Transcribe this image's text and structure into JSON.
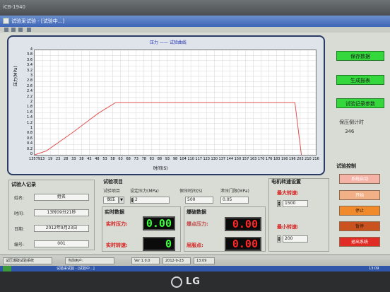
{
  "bezel": {
    "label": "iCB-1940"
  },
  "window": {
    "title": "试验采试验 - [试验中...]"
  },
  "chart": {
    "title": "压力 —— 试验曲线",
    "ylabel": "压力(MPa)",
    "xlabel": "时间(S)",
    "colors": {
      "curve": "#e2504f",
      "background": "#ffffff"
    }
  },
  "chart_data": {
    "type": "line",
    "title": "压力 —— 试验曲线",
    "xlabel": "时间(S)",
    "ylabel": "压力(MPa)",
    "xlim": [
      1,
      216
    ],
    "ylim": [
      0,
      4
    ],
    "grid": true,
    "yticks": [
      "0",
      "0.2",
      "0.4",
      "0.6",
      "0.8",
      "1",
      "1.2",
      "1.4",
      "1.6",
      "1.8",
      "2",
      "2.2",
      "2.4",
      "2.6",
      "2.8",
      "3",
      "3.2",
      "3.4",
      "3.6",
      "3.8",
      "4"
    ],
    "xticks": [
      "13579",
      "13",
      "19",
      "23",
      "28",
      "33",
      "38",
      "43",
      "48",
      "53",
      "58",
      "63",
      "68",
      "73",
      "78",
      "83",
      "88",
      "93",
      "98",
      "104",
      "110",
      "117",
      "123",
      "130",
      "137",
      "144",
      "150",
      "157",
      "163",
      "170",
      "176",
      "183",
      "190",
      "196",
      "203",
      "210",
      "216"
    ],
    "series": [
      {
        "x": [
          1,
          10,
          30,
          50,
          63,
          70,
          200,
          203,
          205
        ],
        "y": [
          0,
          0.15,
          0.85,
          1.6,
          2.0,
          2.0,
          2.0,
          0.8,
          0
        ]
      }
    ]
  },
  "side_buttons": {
    "save": "保存数据",
    "report": "生成报表",
    "params": "试验记录参数"
  },
  "hold_timer": {
    "label": "保压倒计时",
    "value": "346"
  },
  "record": {
    "title": "试验人记录",
    "name_label": "姓名:",
    "name_value": "姓名",
    "time_label": "时间:",
    "time_value": "13时09分21秒",
    "date_label": "日期:",
    "date_value": "2012年9月23日",
    "id_label": "编号:",
    "id_value": "001"
  },
  "project": {
    "title": "试验项目",
    "item_label": "试验项目",
    "item_value": "保压",
    "pressure_label": "设定压力(MPa)",
    "pressure_value": "2",
    "hold_label": "保压时间(S)",
    "hold_value": "500",
    "leak_label": "泄压门限(MPa)",
    "leak_value": "0.05"
  },
  "realtime": {
    "title": "实时数据",
    "pressure_label": "实时压力:",
    "pressure_value": "0.00",
    "speed_label": "实时转速:",
    "speed_value": "0"
  },
  "burst": {
    "title": "爆破数据",
    "burst_label": "爆点压力:",
    "burst_value": "0.00",
    "yield_label": "屈服点:",
    "yield_value": "0.00"
  },
  "motor": {
    "title": "电机转速设置",
    "max_label": "最大转速:",
    "max_value": "1500",
    "min_label": "最小转速:",
    "min_value": "200"
  },
  "control": {
    "title": "试验控制",
    "start_system": "系统启动",
    "start": "开始",
    "stop": "停止",
    "pause": "暂停",
    "exit": "退出系统"
  },
  "taskbar": {
    "app": "试压爆破试验系统",
    "user": "当前用户:",
    "version": "Ver 1.0.0",
    "date": "2012-9-23",
    "time": "13:09"
  },
  "startbar": {
    "item": "试验采试验 - [试验中...]"
  },
  "brand": {
    "name": "LG"
  }
}
